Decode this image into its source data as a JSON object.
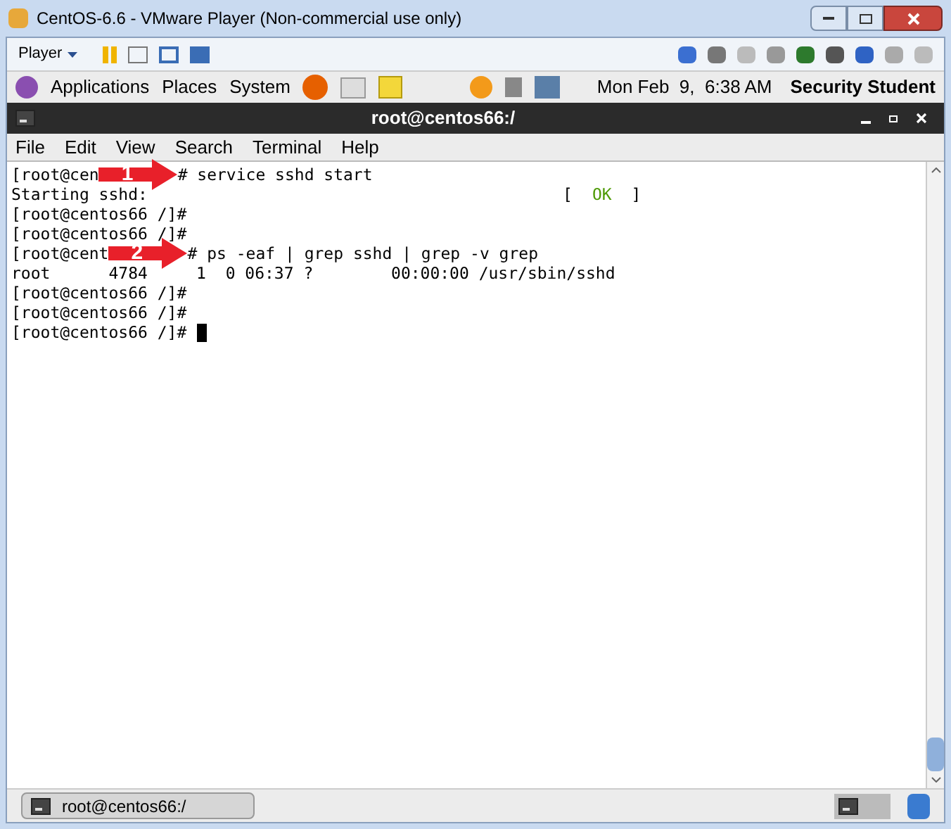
{
  "window": {
    "title": "CentOS-6.6 - VMware Player (Non-commercial use only)"
  },
  "toolbar": {
    "player_menu": "Player"
  },
  "panel": {
    "menus": [
      "Applications",
      "Places",
      "System"
    ],
    "clock": "Mon Feb  9,  6:38 AM",
    "user": "Security Student"
  },
  "terminal": {
    "title": "root@centos66:/",
    "menu": [
      "File",
      "Edit",
      "View",
      "Search",
      "Terminal",
      "Help"
    ],
    "lines": [
      {
        "kind": "annotated",
        "before": "[root@cen",
        "label": "1",
        "after": "# service sshd start"
      },
      {
        "kind": "status",
        "text": "Starting sshd:",
        "open": "[",
        "status": "OK",
        "close": "]"
      },
      {
        "kind": "text",
        "text": "[root@centos66 /]#"
      },
      {
        "kind": "text",
        "text": "[root@centos66 /]#"
      },
      {
        "kind": "annotated",
        "before": "[root@cent",
        "label": "2",
        "after": "# ps -eaf | grep sshd | grep -v grep"
      },
      {
        "kind": "text",
        "text": "root      4784     1  0 06:37 ?        00:00:00 /usr/sbin/sshd"
      },
      {
        "kind": "text",
        "text": "[root@centos66 /]#"
      },
      {
        "kind": "text",
        "text": "[root@centos66 /]#"
      },
      {
        "kind": "prompt",
        "text": "[root@centos66 /]# "
      }
    ]
  },
  "taskbar": {
    "window_button": "root@centos66:/"
  }
}
